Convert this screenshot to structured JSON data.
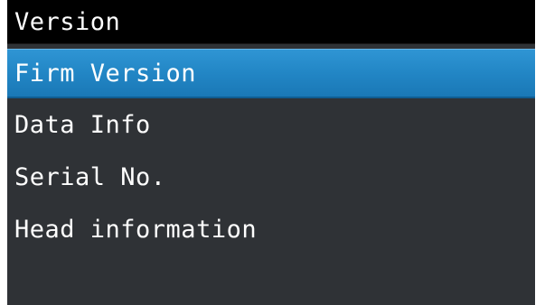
{
  "screen": {
    "title": "Version",
    "items": [
      {
        "label": "Firm Version",
        "selected": true
      },
      {
        "label": "Data Info",
        "selected": false
      },
      {
        "label": "Serial No.",
        "selected": false
      },
      {
        "label": "Head information",
        "selected": false
      }
    ]
  },
  "colors": {
    "background": "#2f3236",
    "titlebar": "#000000",
    "selection": "#2286c5",
    "text": "#ffffff"
  }
}
